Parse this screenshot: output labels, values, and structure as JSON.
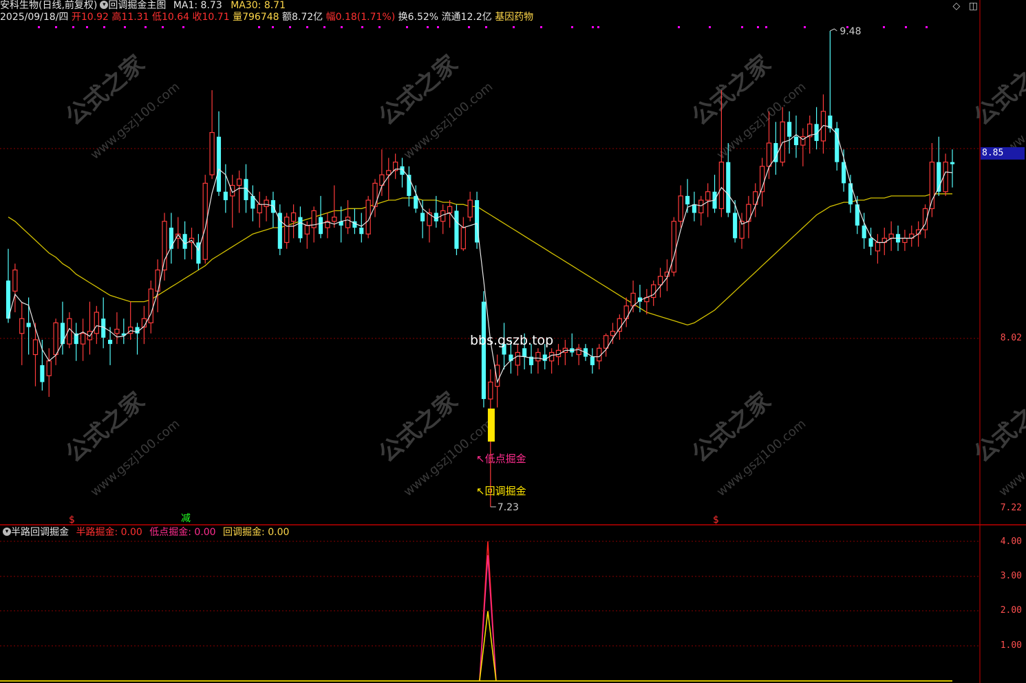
{
  "header": {
    "stock_name": "安科生物(日线,前复权)",
    "formula_name": "回调掘金主图",
    "ma1": "MA1: 8.73",
    "ma30": "MA30: 8.71",
    "date": "2025/09/18/四",
    "open_label": "开",
    "open": "10.92",
    "high_label": "高",
    "high": "11.31",
    "low_label": "低",
    "low": "10.64",
    "close_label": "收",
    "close": "10.71",
    "volume_label": "量",
    "volume": "796748",
    "amount_label": "额",
    "amount": "8.72亿",
    "change_label": "幅",
    "change": "0.18(1.71%)",
    "turnover_label": "换",
    "turnover": "6.52%",
    "float_label": "流通",
    "float_cap": "12.2亿",
    "sector": "基因药物"
  },
  "toolbar_icons": [
    "diamond-icon",
    "window-icon"
  ],
  "price_axis": {
    "labels": [
      "8.85",
      "8.02",
      "7.22"
    ],
    "current_price": "8.85"
  },
  "annotations": {
    "high_mark": "9.48",
    "low_mark": "7.23",
    "watermark_url": "bbs.gszb.top",
    "signal_low": "低点掘金",
    "signal_pullback": "回调掘金",
    "bottom_marker_reduce": "减",
    "bottom_marker_s": "$",
    "watermark_text": "公式之家",
    "watermark_site": "www.gszj100.com"
  },
  "indicator": {
    "name": "半路回调掘金",
    "line1_label": "半路掘金",
    "line1_value": ": 0.00",
    "line2_label": "低点掘金",
    "line2_value": ": 0.00",
    "line3_label": "回调掘金",
    "line3_value": ": 0.00",
    "axis_labels": [
      "4.00",
      "3.00",
      "2.00",
      "1.00"
    ]
  },
  "colors": {
    "up_candle": "#ff3b3b",
    "down_candle": "#54ffff",
    "ma1": "#e8e8e8",
    "ma30": "#d4c200",
    "grid": "#8b0000",
    "signal_magenta": "#ff2d8e",
    "signal_yellow": "#ffe600"
  },
  "chart_data": {
    "type": "candlestick",
    "ylim": [
      7.22,
      9.48
    ],
    "yticks": [
      8.85,
      8.02,
      7.22
    ],
    "candles": [
      [
        8.3,
        8.45,
        8.1,
        8.12
      ],
      [
        8.25,
        8.38,
        8.15,
        8.35
      ],
      [
        8.05,
        8.2,
        7.9,
        8.12
      ],
      [
        8.1,
        8.22,
        7.95,
        8.08
      ],
      [
        7.95,
        8.1,
        7.8,
        8.02
      ],
      [
        7.9,
        8.02,
        7.78,
        7.82
      ],
      [
        7.85,
        7.98,
        7.75,
        7.92
      ],
      [
        7.95,
        8.12,
        7.9,
        8.1
      ],
      [
        8.1,
        8.2,
        7.95,
        8.0
      ],
      [
        8.0,
        8.15,
        7.98,
        8.12
      ],
      [
        8.05,
        8.1,
        7.92,
        8.0
      ],
      [
        8.0,
        8.12,
        7.92,
        8.05
      ],
      [
        8.02,
        8.2,
        7.95,
        8.06
      ],
      [
        8.05,
        8.18,
        8.0,
        8.15
      ],
      [
        8.12,
        8.22,
        7.98,
        8.03
      ],
      [
        8.02,
        8.08,
        7.9,
        8.0
      ],
      [
        8.05,
        8.15,
        8.0,
        8.07
      ],
      [
        8.05,
        8.12,
        8.0,
        8.04
      ],
      [
        8.05,
        8.2,
        8.02,
        8.08
      ],
      [
        8.08,
        8.1,
        7.95,
        8.05
      ],
      [
        8.08,
        8.18,
        8.0,
        8.12
      ],
      [
        8.1,
        8.3,
        8.05,
        8.26
      ],
      [
        8.25,
        8.4,
        8.15,
        8.35
      ],
      [
        8.35,
        8.62,
        8.3,
        8.58
      ],
      [
        8.55,
        8.62,
        8.38,
        8.45
      ],
      [
        8.5,
        8.6,
        8.45,
        8.52
      ],
      [
        8.52,
        8.58,
        8.4,
        8.45
      ],
      [
        8.48,
        8.55,
        8.4,
        8.5
      ],
      [
        8.48,
        8.52,
        8.35,
        8.38
      ],
      [
        8.4,
        8.8,
        8.38,
        8.76
      ],
      [
        8.8,
        9.2,
        8.78,
        9.0
      ],
      [
        8.98,
        9.1,
        8.7,
        8.72
      ],
      [
        8.72,
        8.85,
        8.62,
        8.68
      ],
      [
        8.7,
        8.8,
        8.55,
        8.75
      ],
      [
        8.75,
        8.82,
        8.62,
        8.78
      ],
      [
        8.78,
        8.85,
        8.62,
        8.68
      ],
      [
        8.7,
        8.75,
        8.58,
        8.64
      ],
      [
        8.62,
        8.72,
        8.55,
        8.66
      ],
      [
        8.65,
        8.7,
        8.58,
        8.68
      ],
      [
        8.68,
        8.72,
        8.55,
        8.62
      ],
      [
        8.62,
        8.66,
        8.42,
        8.45
      ],
      [
        8.48,
        8.62,
        8.45,
        8.6
      ],
      [
        8.58,
        8.66,
        8.5,
        8.62
      ],
      [
        8.6,
        8.65,
        8.48,
        8.5
      ],
      [
        8.52,
        8.58,
        8.45,
        8.56
      ],
      [
        8.55,
        8.65,
        8.48,
        8.63
      ],
      [
        8.6,
        8.7,
        8.5,
        8.52
      ],
      [
        8.55,
        8.62,
        8.5,
        8.58
      ],
      [
        8.58,
        8.75,
        8.55,
        8.6
      ],
      [
        8.58,
        8.65,
        8.48,
        8.56
      ],
      [
        8.55,
        8.68,
        8.52,
        8.6
      ],
      [
        8.58,
        8.64,
        8.52,
        8.55
      ],
      [
        8.55,
        8.62,
        8.48,
        8.52
      ],
      [
        8.52,
        8.7,
        8.5,
        8.68
      ],
      [
        8.65,
        8.78,
        8.6,
        8.76
      ],
      [
        8.75,
        8.92,
        8.7,
        8.8
      ],
      [
        8.8,
        8.88,
        8.68,
        8.82
      ],
      [
        8.82,
        8.9,
        8.78,
        8.86
      ],
      [
        8.84,
        8.88,
        8.74,
        8.8
      ],
      [
        8.8,
        8.84,
        8.65,
        8.7
      ],
      [
        8.7,
        8.75,
        8.62,
        8.64
      ],
      [
        8.62,
        8.68,
        8.5,
        8.58
      ],
      [
        8.56,
        8.64,
        8.48,
        8.62
      ],
      [
        8.62,
        8.7,
        8.55,
        8.58
      ],
      [
        8.58,
        8.66,
        8.52,
        8.63
      ],
      [
        8.62,
        8.68,
        8.55,
        8.65
      ],
      [
        8.63,
        8.66,
        8.42,
        8.45
      ],
      [
        8.45,
        8.6,
        8.44,
        8.55
      ],
      [
        8.6,
        8.72,
        8.58,
        8.68
      ],
      [
        8.68,
        8.72,
        8.45,
        8.48
      ],
      [
        8.2,
        8.25,
        7.7,
        7.74
      ],
      [
        7.74,
        7.88,
        7.23,
        7.82
      ],
      [
        7.8,
        7.95,
        7.7,
        7.9
      ],
      [
        8.0,
        8.1,
        7.88,
        7.95
      ],
      [
        7.95,
        8.02,
        7.86,
        7.92
      ],
      [
        7.9,
        8.0,
        7.85,
        7.96
      ],
      [
        7.98,
        8.05,
        7.88,
        7.94
      ],
      [
        7.94,
        8.0,
        7.86,
        7.9
      ],
      [
        7.92,
        7.98,
        7.86,
        7.96
      ],
      [
        7.95,
        8.0,
        7.88,
        7.92
      ],
      [
        7.92,
        7.98,
        7.86,
        7.96
      ],
      [
        7.94,
        8.0,
        7.9,
        7.97
      ],
      [
        7.96,
        8.02,
        7.9,
        7.98
      ],
      [
        7.98,
        8.05,
        7.94,
        7.96
      ],
      [
        7.95,
        8.0,
        7.9,
        7.98
      ],
      [
        7.98,
        8.0,
        7.92,
        7.94
      ],
      [
        7.94,
        7.98,
        7.86,
        7.9
      ],
      [
        7.92,
        8.0,
        7.88,
        7.98
      ],
      [
        7.98,
        8.05,
        7.94,
        8.04
      ],
      [
        8.04,
        8.1,
        8.0,
        8.06
      ],
      [
        8.06,
        8.14,
        8.02,
        8.12
      ],
      [
        8.12,
        8.22,
        8.08,
        8.18
      ],
      [
        8.18,
        8.3,
        8.15,
        8.24
      ],
      [
        8.22,
        8.28,
        8.15,
        8.2
      ],
      [
        8.2,
        8.26,
        8.14,
        8.22
      ],
      [
        8.22,
        8.3,
        8.18,
        8.28
      ],
      [
        8.28,
        8.36,
        8.22,
        8.32
      ],
      [
        8.32,
        8.4,
        8.25,
        8.34
      ],
      [
        8.34,
        8.6,
        8.32,
        8.58
      ],
      [
        8.58,
        8.75,
        8.55,
        8.7
      ],
      [
        8.7,
        8.78,
        8.62,
        8.66
      ],
      [
        8.66,
        8.72,
        8.58,
        8.62
      ],
      [
        8.62,
        8.7,
        8.56,
        8.68
      ],
      [
        8.68,
        8.76,
        8.6,
        8.72
      ],
      [
        8.72,
        8.8,
        8.62,
        8.64
      ],
      [
        8.64,
        9.2,
        8.6,
        8.86
      ],
      [
        8.86,
        8.95,
        8.6,
        8.62
      ],
      [
        8.62,
        8.68,
        8.48,
        8.5
      ],
      [
        8.5,
        8.62,
        8.45,
        8.58
      ],
      [
        8.58,
        8.7,
        8.5,
        8.66
      ],
      [
        8.66,
        8.76,
        8.6,
        8.72
      ],
      [
        8.72,
        8.88,
        8.65,
        8.84
      ],
      [
        8.84,
        9.1,
        8.78,
        8.95
      ],
      [
        8.95,
        9.05,
        8.8,
        8.86
      ],
      [
        8.86,
        9.12,
        8.84,
        9.05
      ],
      [
        9.05,
        9.1,
        8.9,
        8.98
      ],
      [
        8.98,
        9.08,
        8.88,
        8.94
      ],
      [
        8.94,
        9.02,
        8.84,
        8.98
      ],
      [
        8.98,
        9.08,
        8.9,
        9.04
      ],
      [
        9.04,
        9.12,
        8.92,
        8.96
      ],
      [
        8.96,
        9.18,
        8.9,
        9.1
      ],
      [
        9.08,
        9.48,
        9.0,
        9.02
      ],
      [
        9.02,
        9.05,
        8.82,
        8.86
      ],
      [
        8.86,
        8.92,
        8.72,
        8.76
      ],
      [
        8.76,
        8.8,
        8.62,
        8.66
      ],
      [
        8.66,
        8.7,
        8.52,
        8.56
      ],
      [
        8.56,
        8.62,
        8.45,
        8.5
      ],
      [
        8.5,
        8.55,
        8.42,
        8.46
      ],
      [
        8.44,
        8.52,
        8.38,
        8.48
      ],
      [
        8.48,
        8.55,
        8.42,
        8.5
      ],
      [
        8.5,
        8.58,
        8.44,
        8.52
      ],
      [
        8.52,
        8.56,
        8.44,
        8.48
      ],
      [
        8.48,
        8.54,
        8.44,
        8.5
      ],
      [
        8.5,
        8.56,
        8.46,
        8.52
      ],
      [
        8.52,
        8.58,
        8.46,
        8.54
      ],
      [
        8.54,
        8.66,
        8.5,
        8.64
      ],
      [
        8.64,
        8.95,
        8.6,
        8.86
      ],
      [
        8.86,
        8.98,
        8.7,
        8.72
      ],
      [
        8.72,
        8.9,
        8.7,
        8.86
      ],
      [
        8.86,
        8.92,
        8.74,
        8.85
      ]
    ],
    "ma1_line": "close",
    "ma30_values": [
      8.6,
      8.58,
      8.55,
      8.52,
      8.49,
      8.46,
      8.43,
      8.41,
      8.38,
      8.36,
      8.33,
      8.31,
      8.29,
      8.27,
      8.25,
      8.23,
      8.22,
      8.21,
      8.2,
      8.2,
      8.2,
      8.21,
      8.23,
      8.25,
      8.27,
      8.29,
      8.31,
      8.33,
      8.35,
      8.37,
      8.4,
      8.42,
      8.44,
      8.46,
      8.48,
      8.5,
      8.52,
      8.53,
      8.54,
      8.55,
      8.55,
      8.56,
      8.57,
      8.58,
      8.59,
      8.6,
      8.61,
      8.62,
      8.63,
      8.63,
      8.64,
      8.64,
      8.64,
      8.65,
      8.66,
      8.67,
      8.68,
      8.68,
      8.69,
      8.69,
      8.69,
      8.68,
      8.68,
      8.68,
      8.67,
      8.67,
      8.66,
      8.66,
      8.65,
      8.65,
      8.63,
      8.61,
      8.59,
      8.57,
      8.55,
      8.53,
      8.51,
      8.49,
      8.47,
      8.45,
      8.43,
      8.41,
      8.39,
      8.37,
      8.35,
      8.33,
      8.31,
      8.29,
      8.27,
      8.25,
      8.23,
      8.21,
      8.19,
      8.17,
      8.15,
      8.14,
      8.13,
      8.12,
      8.11,
      8.1,
      8.09,
      8.1,
      8.12,
      8.14,
      8.16,
      8.19,
      8.22,
      8.25,
      8.28,
      8.31,
      8.34,
      8.37,
      8.4,
      8.43,
      8.46,
      8.49,
      8.52,
      8.55,
      8.58,
      8.61,
      8.63,
      8.65,
      8.66,
      8.67,
      8.67,
      8.68,
      8.68,
      8.69,
      8.69,
      8.69,
      8.7,
      8.7,
      8.7,
      8.7,
      8.7,
      8.7,
      8.71,
      8.71,
      8.71,
      8.71
    ],
    "signals": [
      {
        "index": 70,
        "label": "低点掘金"
      },
      {
        "index": 71,
        "label": "回调掘金"
      }
    ],
    "indicator_series": [
      {
        "name": "半路掘金",
        "peak_index": 70,
        "peak_value": 4.0
      },
      {
        "name": "低点掘金",
        "peak_index": 70,
        "peak_value": 3.6
      },
      {
        "name": "回调掘金",
        "peak_index": 70,
        "peak_value": 2.0
      }
    ],
    "indicator_ylim": [
      0,
      4.2
    ]
  }
}
